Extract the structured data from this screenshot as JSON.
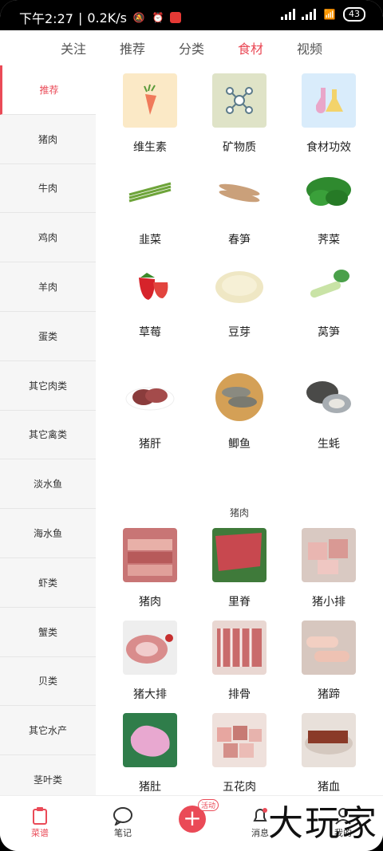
{
  "status_bar": {
    "time": "下午2:27",
    "speed": "0.2K/s",
    "battery": "43"
  },
  "tabs": [
    {
      "label": "关注"
    },
    {
      "label": "推荐"
    },
    {
      "label": "分类"
    },
    {
      "label": "食材",
      "active": true
    },
    {
      "label": "视频"
    }
  ],
  "sidebar": {
    "items": [
      {
        "label": "推荐",
        "active": true
      },
      {
        "label": "猪肉"
      },
      {
        "label": "牛肉"
      },
      {
        "label": "鸡肉"
      },
      {
        "label": "羊肉"
      },
      {
        "label": "蛋类"
      },
      {
        "label": "其它肉类"
      },
      {
        "label": "其它禽类"
      },
      {
        "label": "淡水鱼"
      },
      {
        "label": "海水鱼"
      },
      {
        "label": "虾类"
      },
      {
        "label": "蟹类"
      },
      {
        "label": "贝类"
      },
      {
        "label": "其它水产"
      },
      {
        "label": "茎叶类"
      }
    ]
  },
  "grid_recommend": {
    "items": [
      {
        "label": "维生素",
        "icon": "carrot-icon"
      },
      {
        "label": "矿物质",
        "icon": "molecule-icon"
      },
      {
        "label": "食材功效",
        "icon": "flask-icon"
      },
      {
        "label": "韭菜"
      },
      {
        "label": "春笋"
      },
      {
        "label": "荠菜"
      },
      {
        "label": "草莓"
      },
      {
        "label": "豆芽"
      },
      {
        "label": "莴笋"
      },
      {
        "label": "猪肝"
      },
      {
        "label": "鲫鱼"
      },
      {
        "label": "生蚝"
      }
    ]
  },
  "section_pork": {
    "title": "猪肉",
    "items": [
      {
        "label": "猪肉"
      },
      {
        "label": "里脊"
      },
      {
        "label": "猪小排"
      },
      {
        "label": "猪大排"
      },
      {
        "label": "排骨"
      },
      {
        "label": "猪蹄"
      },
      {
        "label": "猪肚"
      },
      {
        "label": "五花肉"
      },
      {
        "label": "猪血"
      }
    ]
  },
  "bottom_nav": {
    "recipes": "菜谱",
    "notes": "笔记",
    "activity_badge": "活动",
    "messages": "消息",
    "mine": "我的"
  },
  "watermark": "大玩家"
}
